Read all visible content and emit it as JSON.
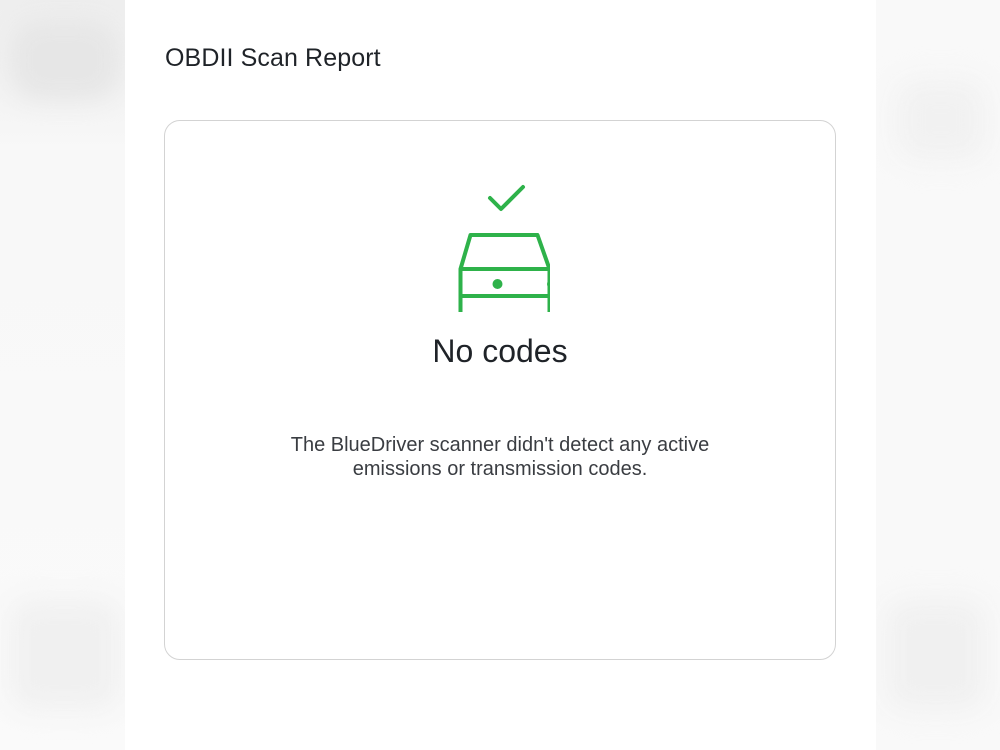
{
  "report": {
    "title": "OBDII Scan Report"
  },
  "status": {
    "icon": "car-check-icon",
    "title": "No codes",
    "description_lines": [
      "The BlueDriver scanner didn't detect any active",
      "emissions or transmission codes."
    ]
  },
  "colors": {
    "accent": "#2eb24a",
    "title_text": "#1f2328",
    "body_text": "#3a3d42",
    "card_border": "#d3d3d3"
  }
}
